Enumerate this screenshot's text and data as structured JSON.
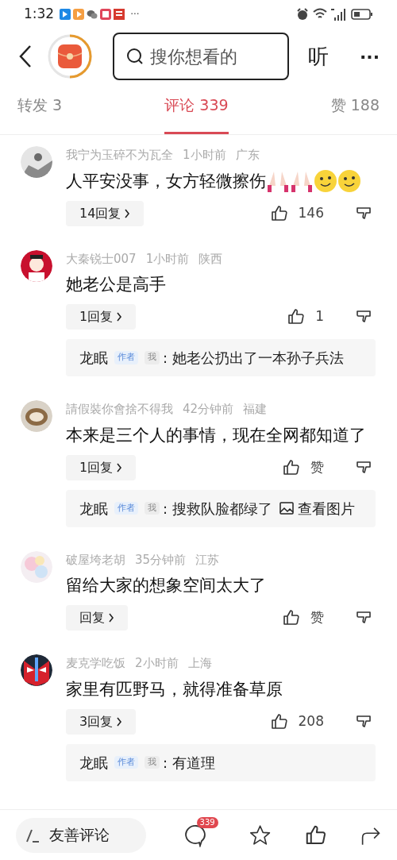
{
  "status_bar": {
    "time": "1:32",
    "more": "···"
  },
  "header": {
    "search_placeholder": "搜你想看的",
    "listen": "听",
    "more": "···"
  },
  "tabs": [
    {
      "label": "转发 3",
      "selected": false
    },
    {
      "label": "评论 339",
      "selected": true
    },
    {
      "label": "赞 188",
      "selected": false
    }
  ],
  "comments": [
    {
      "user": "我宁为玉碎不为瓦全",
      "time": "1小时前",
      "region": "广东",
      "text": "人平安没事，女方轻微擦伤",
      "emojis": [
        {
          "kind": "pray"
        },
        {
          "kind": "pray"
        },
        {
          "kind": "grin"
        },
        {
          "kind": "grin"
        }
      ],
      "replies": "14回复",
      "likes": "146"
    },
    {
      "user": "大秦锐士007",
      "time": "1小时前",
      "region": "陕西",
      "text": "她老公是高手",
      "replies": "1回复",
      "likes": "1",
      "author_reply": {
        "name": "龙眠",
        "badge": "作者",
        "me": "我",
        "text": ": 她老公扔出了一本孙子兵法"
      }
    },
    {
      "user": "請假裝你會捨不得我",
      "time": "42分钟前",
      "region": "福建",
      "text": "本来是三个人的事情，现在全网都知道了",
      "replies": "1回复",
      "likes": "赞",
      "author_reply": {
        "name": "龙眠",
        "badge": "作者",
        "me": "我",
        "text": ": 搜救队脸都绿了",
        "image_link": "查看图片"
      }
    },
    {
      "user": "破屋垮老胡",
      "time": "35分钟前",
      "region": "江苏",
      "text": "留给大家的想象空间太大了",
      "replies": "回复",
      "likes": "赞"
    },
    {
      "user": "麦克学吃饭",
      "time": "2小时前",
      "region": "上海",
      "text": "家里有匹野马，就得准备草原",
      "replies": "3回复",
      "likes": "208",
      "author_reply": {
        "name": "龙眠",
        "badge": "作者",
        "me": "我",
        "text": ": 有道理"
      }
    }
  ],
  "bottom_bar": {
    "input_placeholder": "友善评论",
    "comment_count": "339"
  }
}
